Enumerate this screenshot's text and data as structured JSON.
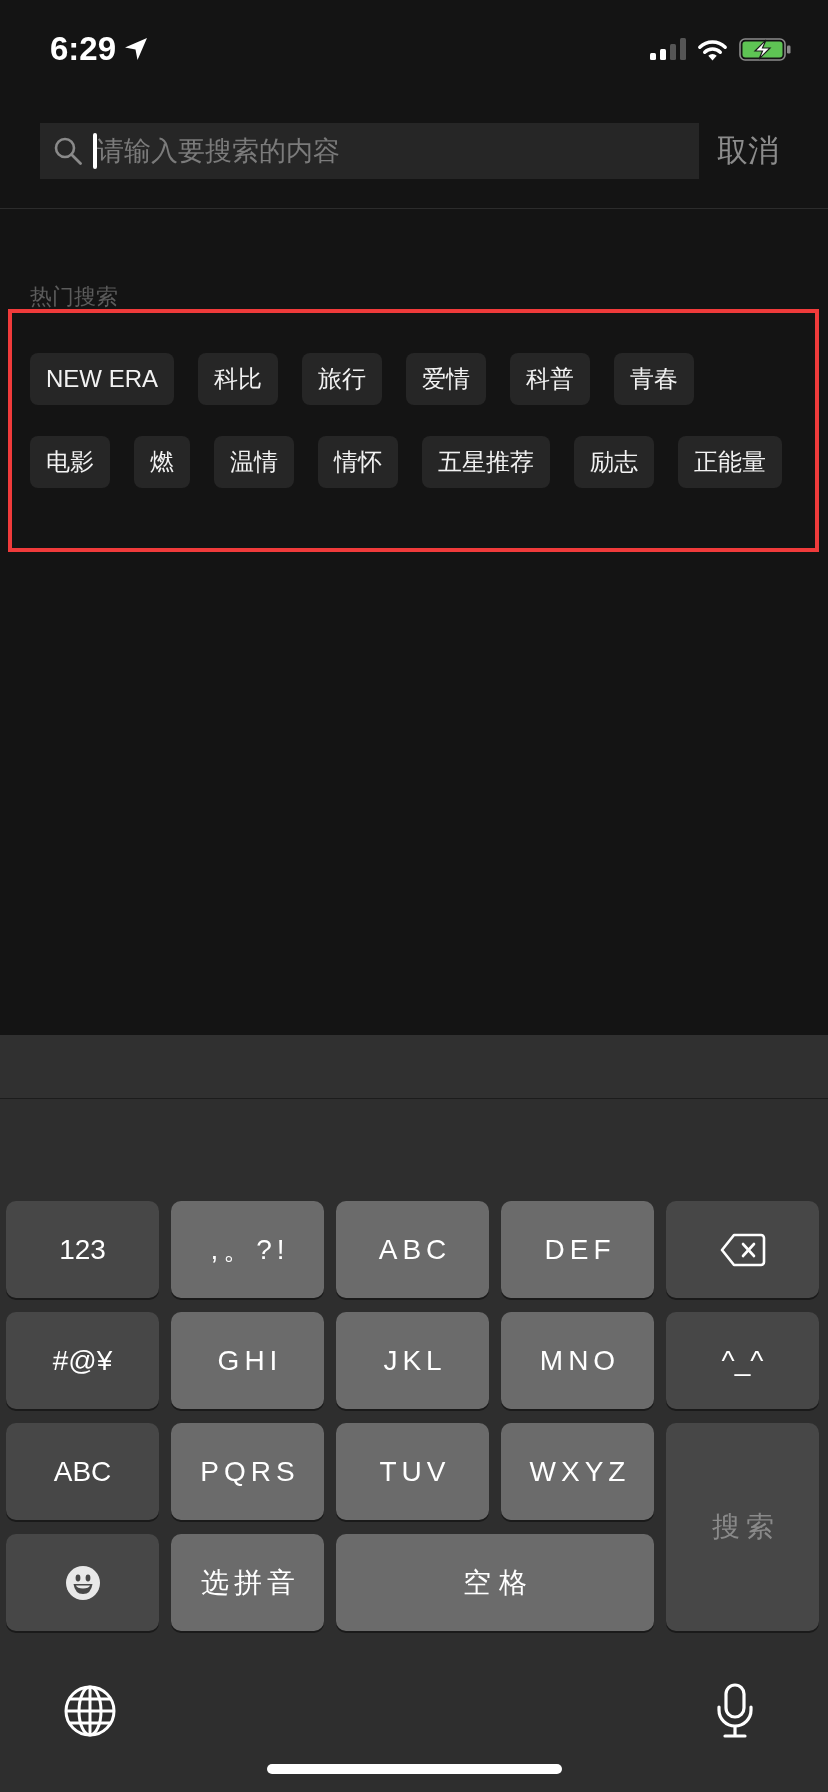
{
  "status_bar": {
    "time": "6:29"
  },
  "search": {
    "placeholder": "请输入要搜索的内容",
    "focused": true,
    "cancel": "取消"
  },
  "hot_searches": {
    "title": "热门搜索",
    "highlighted": true,
    "rows": [
      {
        "tags": [
          "NEW ERA",
          "科比",
          "旅行",
          "爱情",
          "科普",
          "青春"
        ]
      },
      {
        "tags": [
          "电影",
          "燃",
          "温情",
          "情怀",
          "五星推荐",
          "励志",
          "正能量"
        ]
      }
    ]
  },
  "keyboard": {
    "keys": [
      {
        "kind": "function",
        "label": "123",
        "disabled": false
      },
      {
        "kind": "letter",
        "label": ",。?!",
        "disabled": false
      },
      {
        "kind": "letter",
        "label": "ABC",
        "disabled": false
      },
      {
        "kind": "letter",
        "label": "DEF",
        "disabled": false
      },
      {
        "kind": "backspace",
        "disabled": false
      },
      {
        "kind": "function",
        "label": "#@¥",
        "disabled": false
      },
      {
        "kind": "letter",
        "label": "GHI",
        "disabled": false
      },
      {
        "kind": "letter",
        "label": "JKL",
        "disabled": false
      },
      {
        "kind": "letter",
        "label": "MNO",
        "disabled": false
      },
      {
        "kind": "function",
        "label": "^_^",
        "disabled": false
      },
      {
        "kind": "function",
        "label": "ABC",
        "disabled": false
      },
      {
        "kind": "letter",
        "label": "PQRS",
        "disabled": false
      },
      {
        "kind": "letter",
        "label": "TUV",
        "disabled": false
      },
      {
        "kind": "letter",
        "label": "WXYZ",
        "disabled": false
      },
      {
        "kind": "return",
        "label": "搜索",
        "disabled": true
      },
      {
        "kind": "emoji",
        "disabled": false
      },
      {
        "kind": "letter",
        "label": "选拼音",
        "disabled": false
      },
      {
        "kind": "space",
        "label": "空格",
        "disabled": false
      }
    ]
  }
}
